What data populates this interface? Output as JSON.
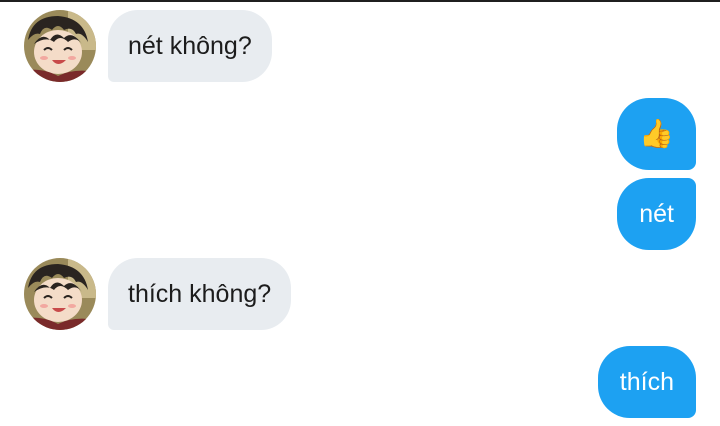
{
  "colors": {
    "incoming_bubble": "#e8ecf0",
    "outgoing_bubble": "#1da1f2",
    "incoming_text": "#1c1c1c",
    "outgoing_text": "#ffffff"
  },
  "messages": [
    {
      "direction": "incoming",
      "text": "nét không?",
      "avatar": "anime-boy-avatar"
    },
    {
      "direction": "outgoing",
      "text": "👍",
      "icon": "thumbs-up-icon"
    },
    {
      "direction": "outgoing",
      "text": "nét"
    },
    {
      "direction": "incoming",
      "text": "thích không?",
      "avatar": "anime-boy-avatar"
    },
    {
      "direction": "outgoing",
      "text": "thích"
    }
  ]
}
